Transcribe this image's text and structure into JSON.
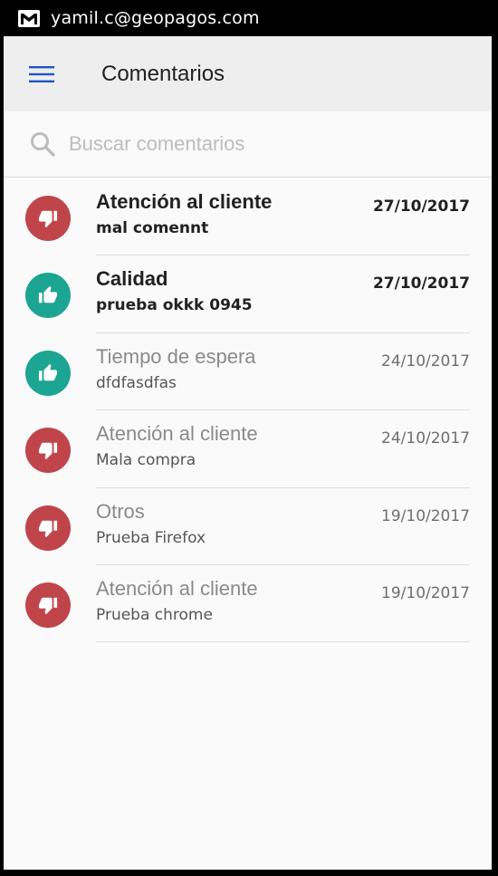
{
  "status_bar": {
    "email": "yamil.c@geopagos.com",
    "icon": "gmail-icon"
  },
  "toolbar": {
    "title": "Comentarios",
    "menu_icon": "hamburger-menu-icon",
    "accent_color": "#1e55c4"
  },
  "search": {
    "placeholder": "Buscar comentarios",
    "value": ""
  },
  "colors": {
    "negative": "#c0454a",
    "positive": "#1ba592"
  },
  "comments": [
    {
      "title": "Atención al cliente",
      "text": "mal comennt",
      "date": "27/10/2017",
      "sentiment": "negative",
      "icon": "thumbs-down-icon",
      "unread": true
    },
    {
      "title": "Calidad",
      "text": "prueba okkk 0945",
      "date": "27/10/2017",
      "sentiment": "positive",
      "icon": "thumbs-up-icon",
      "unread": true
    },
    {
      "title": "Tiempo de espera",
      "text": "dfdfasdfas",
      "date": "24/10/2017",
      "sentiment": "positive",
      "icon": "thumbs-up-icon",
      "unread": false
    },
    {
      "title": "Atención al cliente",
      "text": "Mala compra",
      "date": "24/10/2017",
      "sentiment": "negative",
      "icon": "thumbs-down-icon",
      "unread": false
    },
    {
      "title": "Otros",
      "text": "Prueba Firefox",
      "date": "19/10/2017",
      "sentiment": "negative",
      "icon": "thumbs-down-icon",
      "unread": false
    },
    {
      "title": "Atención al cliente",
      "text": "Prueba chrome",
      "date": "19/10/2017",
      "sentiment": "negative",
      "icon": "thumbs-down-icon",
      "unread": false
    }
  ]
}
